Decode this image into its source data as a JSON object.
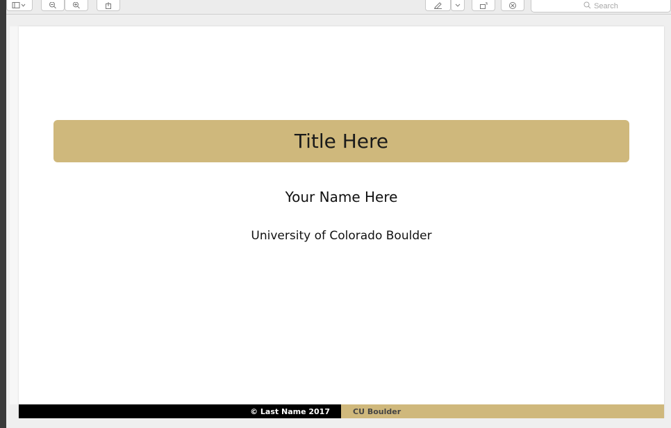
{
  "toolbar": {
    "buttons": [
      {
        "name": "sidebar-toggle",
        "icon": "sidebar-icon"
      },
      {
        "name": "zoom-out",
        "icon": "zoom-out-icon"
      },
      {
        "name": "zoom-in",
        "icon": "zoom-in-icon"
      },
      {
        "name": "share",
        "icon": "share-icon"
      },
      {
        "name": "markup",
        "icon": "pen-icon"
      },
      {
        "name": "markup-menu",
        "icon": "chevron-down-icon"
      },
      {
        "name": "rotate",
        "icon": "rotate-icon"
      },
      {
        "name": "annotate",
        "icon": "annotate-icon"
      }
    ],
    "search_placeholder": "Search"
  },
  "slide": {
    "title": "Title Here",
    "author": "Your Name Here",
    "institute": "University of Colorado Boulder",
    "footer_left": "© Last Name 2017",
    "footer_right": "CU Boulder"
  },
  "colors": {
    "gold": "#cfb87c",
    "black": "#000000",
    "footer_right_text": "#444444"
  }
}
